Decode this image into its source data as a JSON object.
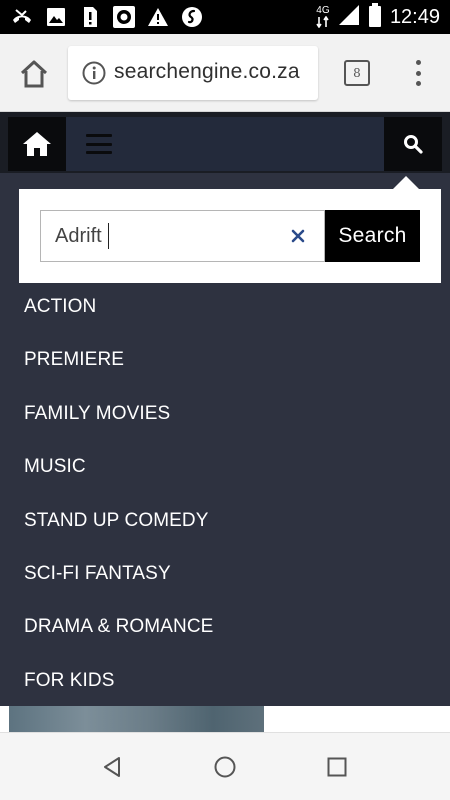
{
  "status_bar": {
    "time": "12:49",
    "network": "4G",
    "icons": [
      "missed-call-icon",
      "image-icon",
      "sim-alert-icon",
      "media-icon",
      "warning-icon",
      "shazam-icon",
      "data-arrows-icon",
      "signal-icon",
      "battery-icon"
    ]
  },
  "browser": {
    "url": "searchengine.co.za",
    "tab_count": "8"
  },
  "search": {
    "value": "Adrift",
    "button_label": "Search"
  },
  "menu": {
    "items": [
      {
        "label": "ACTION"
      },
      {
        "label": "PREMIERE"
      },
      {
        "label": "FAMILY MOVIES"
      },
      {
        "label": "MUSIC"
      },
      {
        "label": "STAND UP COMEDY"
      },
      {
        "label": "SCI-FI FANTASY"
      },
      {
        "label": "DRAMA & ROMANCE"
      },
      {
        "label": "FOR KIDS"
      }
    ]
  },
  "colors": {
    "nav_dark": "#0a0b0d",
    "nav_bar": "#232a3b",
    "dropdown_bg": "#2e3240",
    "clear_icon": "#2a4a8a"
  }
}
